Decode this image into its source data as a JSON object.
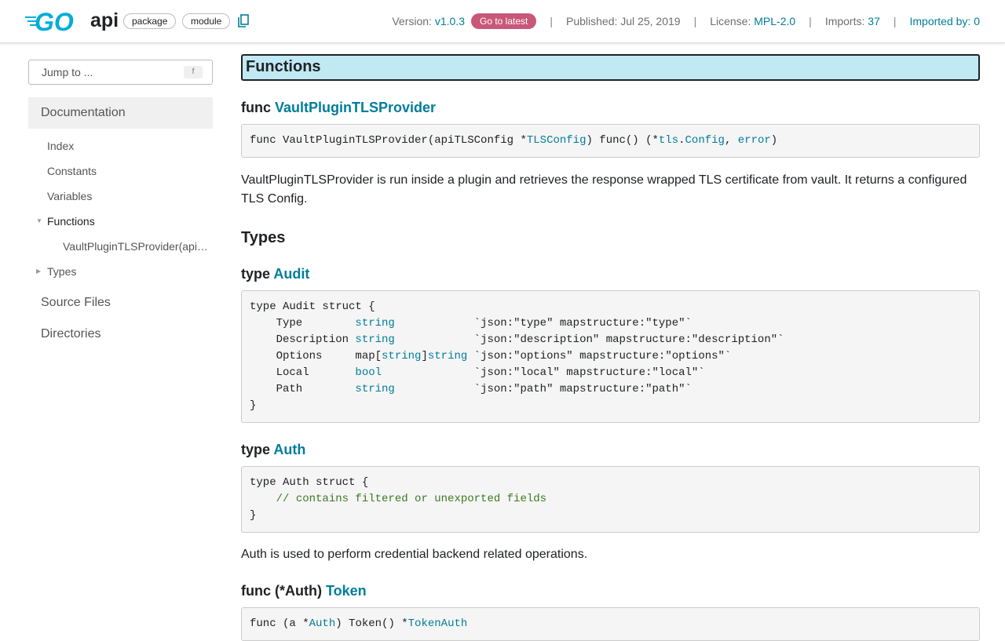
{
  "header": {
    "pkg": "api",
    "chips": [
      "package",
      "module"
    ],
    "version_label": "Version:",
    "version": "v1.0.3",
    "latest": "Go to latest",
    "published": "Published: Jul 25, 2019",
    "license_label": "License:",
    "license": "MPL-2.0",
    "imports_label": "Imports:",
    "imports": "37",
    "imported_by": "Imported by: 0",
    "brand_color": "#00add8"
  },
  "sidebar": {
    "jump_placeholder": "Jump to ...",
    "jump_key": "f",
    "documentation": "Documentation",
    "items": [
      "Index",
      "Constants",
      "Variables",
      "Functions",
      "VaultPluginTLSProvider(api…",
      "Types"
    ],
    "source_files": "Source Files",
    "directories": "Directories"
  },
  "main": {
    "functions_heading": "Functions",
    "func1": {
      "kw": "func",
      "name": "VaultPluginTLSProvider",
      "code": [
        [
          [
            "func VaultPluginTLSProvider(apiTLSConfig *"
          ],
          [
            "TLSConfig",
            1
          ],
          [
            ") func() (*"
          ],
          [
            "tls",
            1
          ],
          [
            "."
          ],
          [
            "Config",
            1
          ],
          [
            ", "
          ],
          [
            "error",
            1
          ],
          [
            ")"
          ]
        ]
      ],
      "desc": "VaultPluginTLSProvider is run inside a plugin and retrieves the response wrapped TLS certificate from vault. It returns a configured TLS Config."
    },
    "types_heading": "Types",
    "audit": {
      "kw": "type",
      "name": "Audit",
      "code": [
        [
          [
            "type Audit struct {"
          ]
        ],
        [
          [
            "    Type        "
          ],
          [
            "string",
            1
          ],
          [
            "            `json:\"type\" mapstructure:\"type\"`"
          ]
        ],
        [
          [
            "    Description "
          ],
          [
            "string",
            1
          ],
          [
            "            `json:\"description\" mapstructure:\"description\"`"
          ]
        ],
        [
          [
            "    Options     map["
          ],
          [
            "string",
            1
          ],
          [
            "]"
          ],
          [
            "string",
            1
          ],
          [
            " `json:\"options\" mapstructure:\"options\"`"
          ]
        ],
        [
          [
            "    Local       "
          ],
          [
            "bool",
            1
          ],
          [
            "              `json:\"local\" mapstructure:\"local\"`"
          ]
        ],
        [
          [
            "    Path        "
          ],
          [
            "string",
            1
          ],
          [
            "            `json:\"path\" mapstructure:\"path\"`"
          ]
        ],
        [
          [
            "}"
          ]
        ]
      ]
    },
    "auth": {
      "kw": "type",
      "name": "Auth",
      "code": [
        [
          [
            "type Auth struct {"
          ]
        ],
        [
          [
            "    "
          ],
          [
            "// contains filtered or unexported fields",
            2
          ]
        ],
        [
          [
            "}"
          ]
        ]
      ],
      "desc": "Auth is used to perform credential backend related operations."
    },
    "token": {
      "kw": "func (*Auth)",
      "name": "Token",
      "code": [
        [
          [
            "func (a *"
          ],
          [
            "Auth",
            1
          ],
          [
            ") Token() *"
          ],
          [
            "TokenAuth",
            1
          ]
        ]
      ]
    }
  }
}
